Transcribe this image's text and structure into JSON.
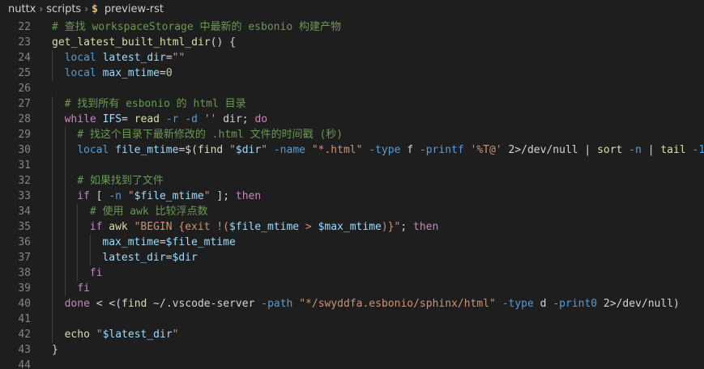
{
  "breadcrumb": {
    "items": [
      "nuttx",
      "scripts"
    ],
    "file_icon": "$",
    "file": "preview-rst"
  },
  "editor": {
    "lines": [
      {
        "n": "22",
        "indent": 0,
        "tokens": [
          {
            "t": "# 查找 workspaceStorage 中最新的 esbonio 构建产物",
            "c": "cm"
          }
        ]
      },
      {
        "n": "23",
        "indent": 0,
        "tokens": [
          {
            "t": "get_latest_built_html_dir",
            "c": "fn"
          },
          {
            "t": "() {",
            "c": "op"
          }
        ]
      },
      {
        "n": "24",
        "indent": 1,
        "tokens": [
          {
            "t": "local",
            "c": "flag"
          },
          {
            "t": " ",
            "c": "op"
          },
          {
            "t": "latest_dir",
            "c": "var"
          },
          {
            "t": "=",
            "c": "op"
          },
          {
            "t": "\"\"",
            "c": "str"
          }
        ]
      },
      {
        "n": "25",
        "indent": 1,
        "tokens": [
          {
            "t": "local",
            "c": "flag"
          },
          {
            "t": " ",
            "c": "op"
          },
          {
            "t": "max_mtime",
            "c": "var"
          },
          {
            "t": "=",
            "c": "op"
          },
          {
            "t": "0",
            "c": "num"
          }
        ]
      },
      {
        "n": "26",
        "indent": 0,
        "tokens": []
      },
      {
        "n": "27",
        "indent": 1,
        "tokens": [
          {
            "t": "# 找到所有 esbonio 的 html 目录",
            "c": "cm"
          }
        ]
      },
      {
        "n": "28",
        "indent": 1,
        "tokens": [
          {
            "t": "while",
            "c": "kw"
          },
          {
            "t": " ",
            "c": "op"
          },
          {
            "t": "IFS",
            "c": "var"
          },
          {
            "t": "= ",
            "c": "op"
          },
          {
            "t": "read",
            "c": "cmd"
          },
          {
            "t": " ",
            "c": "op"
          },
          {
            "t": "-r",
            "c": "flag"
          },
          {
            "t": " ",
            "c": "op"
          },
          {
            "t": "-d",
            "c": "flag"
          },
          {
            "t": " ",
            "c": "op"
          },
          {
            "t": "''",
            "c": "str"
          },
          {
            "t": " dir; ",
            "c": "op"
          },
          {
            "t": "do",
            "c": "kw"
          }
        ]
      },
      {
        "n": "29",
        "indent": 2,
        "tokens": [
          {
            "t": "# 找这个目录下最新修改的 .html 文件的时间戳 (秒)",
            "c": "cm"
          }
        ]
      },
      {
        "n": "30",
        "indent": 2,
        "tokens": [
          {
            "t": "local",
            "c": "flag"
          },
          {
            "t": " ",
            "c": "op"
          },
          {
            "t": "file_mtime",
            "c": "var"
          },
          {
            "t": "=$(",
            "c": "op"
          },
          {
            "t": "find",
            "c": "cmd"
          },
          {
            "t": " ",
            "c": "op"
          },
          {
            "t": "\"",
            "c": "str"
          },
          {
            "t": "$dir",
            "c": "var"
          },
          {
            "t": "\"",
            "c": "str"
          },
          {
            "t": " ",
            "c": "op"
          },
          {
            "t": "-name",
            "c": "flag"
          },
          {
            "t": " ",
            "c": "op"
          },
          {
            "t": "\"*.html\"",
            "c": "str"
          },
          {
            "t": " ",
            "c": "op"
          },
          {
            "t": "-type",
            "c": "flag"
          },
          {
            "t": " f ",
            "c": "op"
          },
          {
            "t": "-printf",
            "c": "flag"
          },
          {
            "t": " ",
            "c": "op"
          },
          {
            "t": "'%T@'",
            "c": "str"
          },
          {
            "t": " 2>/dev/null | ",
            "c": "op"
          },
          {
            "t": "sort",
            "c": "cmd"
          },
          {
            "t": " ",
            "c": "op"
          },
          {
            "t": "-n",
            "c": "flag"
          },
          {
            "t": " | ",
            "c": "op"
          },
          {
            "t": "tail",
            "c": "cmd"
          },
          {
            "t": " ",
            "c": "op"
          },
          {
            "t": "-1",
            "c": "flag"
          },
          {
            "t": ")",
            "c": "op"
          }
        ]
      },
      {
        "n": "31",
        "indent": 2,
        "tokens": []
      },
      {
        "n": "32",
        "indent": 2,
        "tokens": [
          {
            "t": "# 如果找到了文件",
            "c": "cm"
          }
        ]
      },
      {
        "n": "33",
        "indent": 2,
        "tokens": [
          {
            "t": "if",
            "c": "kw"
          },
          {
            "t": " [ ",
            "c": "op"
          },
          {
            "t": "-n",
            "c": "flag"
          },
          {
            "t": " ",
            "c": "op"
          },
          {
            "t": "\"",
            "c": "str"
          },
          {
            "t": "$file_mtime",
            "c": "var"
          },
          {
            "t": "\"",
            "c": "str"
          },
          {
            "t": " ]; ",
            "c": "op"
          },
          {
            "t": "then",
            "c": "kw"
          }
        ]
      },
      {
        "n": "34",
        "indent": 3,
        "tokens": [
          {
            "t": "# 使用 awk 比较浮点数",
            "c": "cm"
          }
        ]
      },
      {
        "n": "35",
        "indent": 3,
        "tokens": [
          {
            "t": "if",
            "c": "kw"
          },
          {
            "t": " ",
            "c": "op"
          },
          {
            "t": "awk",
            "c": "cmd"
          },
          {
            "t": " ",
            "c": "op"
          },
          {
            "t": "\"BEGIN {exit !(",
            "c": "str"
          },
          {
            "t": "$file_mtime",
            "c": "var"
          },
          {
            "t": " > ",
            "c": "str"
          },
          {
            "t": "$max_mtime",
            "c": "var"
          },
          {
            "t": ")}\"",
            "c": "str"
          },
          {
            "t": "; ",
            "c": "op"
          },
          {
            "t": "then",
            "c": "kw"
          }
        ]
      },
      {
        "n": "36",
        "indent": 4,
        "tokens": [
          {
            "t": "max_mtime",
            "c": "var"
          },
          {
            "t": "=",
            "c": "op"
          },
          {
            "t": "$file_mtime",
            "c": "var"
          }
        ]
      },
      {
        "n": "37",
        "indent": 4,
        "tokens": [
          {
            "t": "latest_dir",
            "c": "var"
          },
          {
            "t": "=",
            "c": "op"
          },
          {
            "t": "$dir",
            "c": "var"
          }
        ]
      },
      {
        "n": "38",
        "indent": 3,
        "tokens": [
          {
            "t": "fi",
            "c": "kw"
          }
        ]
      },
      {
        "n": "39",
        "indent": 2,
        "tokens": [
          {
            "t": "fi",
            "c": "kw"
          }
        ]
      },
      {
        "n": "40",
        "indent": 1,
        "tokens": [
          {
            "t": "done",
            "c": "kw"
          },
          {
            "t": " < <(",
            "c": "op"
          },
          {
            "t": "find",
            "c": "cmd"
          },
          {
            "t": " ~/.vscode-server ",
            "c": "op"
          },
          {
            "t": "-path",
            "c": "flag"
          },
          {
            "t": " ",
            "c": "op"
          },
          {
            "t": "\"*/swyddfa.esbonio/sphinx/html\"",
            "c": "str"
          },
          {
            "t": " ",
            "c": "op"
          },
          {
            "t": "-type",
            "c": "flag"
          },
          {
            "t": " d ",
            "c": "op"
          },
          {
            "t": "-print0",
            "c": "flag"
          },
          {
            "t": " 2>/dev/null)",
            "c": "op"
          }
        ]
      },
      {
        "n": "41",
        "indent": 1,
        "tokens": []
      },
      {
        "n": "42",
        "indent": 1,
        "tokens": [
          {
            "t": "echo",
            "c": "cmd"
          },
          {
            "t": " ",
            "c": "op"
          },
          {
            "t": "\"",
            "c": "str"
          },
          {
            "t": "$latest_dir",
            "c": "var"
          },
          {
            "t": "\"",
            "c": "str"
          }
        ]
      },
      {
        "n": "43",
        "indent": 0,
        "tokens": [
          {
            "t": "}",
            "c": "op"
          }
        ]
      },
      {
        "n": "44",
        "indent": 0,
        "tokens": []
      }
    ]
  }
}
